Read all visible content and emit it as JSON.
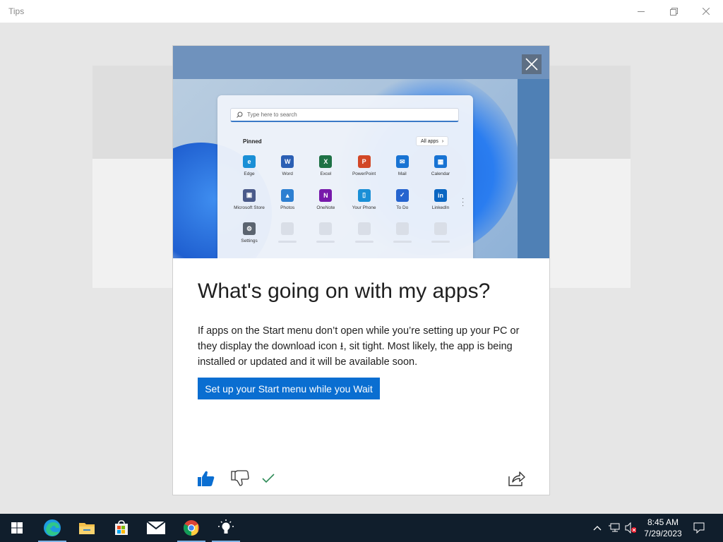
{
  "window": {
    "title": "Tips"
  },
  "card": {
    "headline": "What's going on with my apps?",
    "body_part1": "If apps on the Start menu don’t open while you’re setting up your PC or they display the download icon",
    "download_glyph": "⭳",
    "body_part2": ", sit tight. Most likely, the app is being installed or updated and it will be available soon.",
    "cta_label": "Set up your Start menu while you Wait"
  },
  "start_menu": {
    "search_placeholder": "Type here to search",
    "pinned_label": "Pinned",
    "all_apps_label": "All apps",
    "apps": [
      {
        "label": "Edge",
        "icon": "edge-icon",
        "color": "#1a8fd6"
      },
      {
        "label": "Word",
        "icon": "word-icon",
        "color": "#2b5fb4"
      },
      {
        "label": "Excel",
        "icon": "excel-icon",
        "color": "#1e7145"
      },
      {
        "label": "PowerPoint",
        "icon": "powerpoint-icon",
        "color": "#d24726"
      },
      {
        "label": "Mail",
        "icon": "mail-icon",
        "color": "#1873d3"
      },
      {
        "label": "Calendar",
        "icon": "calendar-icon",
        "color": "#1873d3"
      },
      {
        "label": "Microsoft Store",
        "icon": "store-icon",
        "color": "#4a5a8a"
      },
      {
        "label": "Photos",
        "icon": "photos-icon",
        "color": "#2d7fd1"
      },
      {
        "label": "OneNote",
        "icon": "onenote-icon",
        "color": "#7719aa"
      },
      {
        "label": "Your Phone",
        "icon": "phone-icon",
        "color": "#1a8fd6"
      },
      {
        "label": "To Do",
        "icon": "todo-icon",
        "color": "#2564cf"
      },
      {
        "label": "LinkedIn",
        "icon": "linkedin-icon",
        "color": "#0a66c2"
      },
      {
        "label": "Settings",
        "icon": "settings-icon",
        "color": "#5b6470"
      }
    ]
  },
  "taskbar": {
    "apps": [
      {
        "name": "start-button",
        "icon": "windows-icon"
      },
      {
        "name": "taskbar-edge",
        "icon": "edge-icon"
      },
      {
        "name": "taskbar-file-explorer",
        "icon": "folder-icon"
      },
      {
        "name": "taskbar-store",
        "icon": "store-icon"
      },
      {
        "name": "taskbar-mail",
        "icon": "mail-icon"
      },
      {
        "name": "taskbar-chrome",
        "icon": "chrome-icon"
      },
      {
        "name": "taskbar-tips",
        "icon": "lightbulb-icon"
      }
    ],
    "time": "8:45 AM",
    "date": "7/29/2023"
  },
  "colors": {
    "accent": "#0a6ed1",
    "taskbar": "#101e2c"
  }
}
